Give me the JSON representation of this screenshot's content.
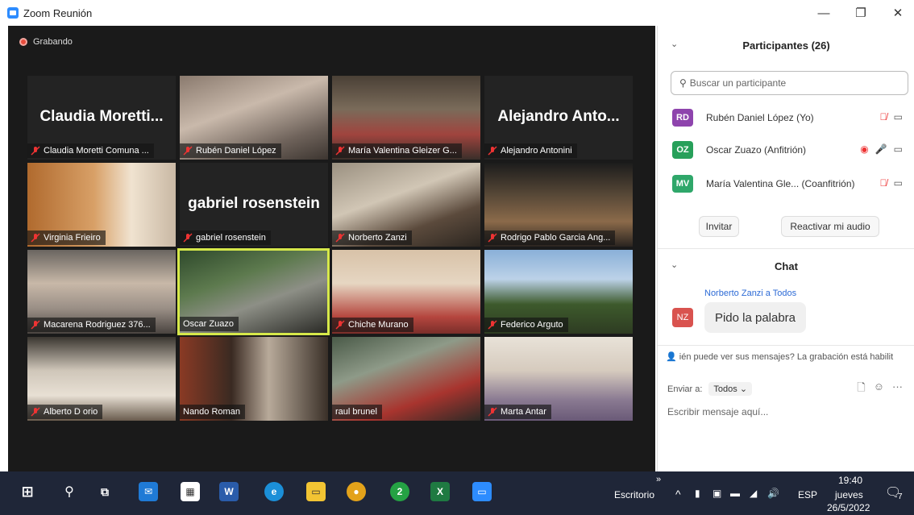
{
  "window": {
    "title": "Zoom Reunión",
    "minimize": "—",
    "maximize": "❐",
    "close": "✕"
  },
  "recording": "Grabando",
  "tiles": [
    {
      "name": "Claudia Moretti Comuna ...",
      "big": "Claudia  Moretti...",
      "muted": true
    },
    {
      "name": "Rubén Daniel López",
      "big": "",
      "muted": true
    },
    {
      "name": "María Valentina Gleizer G...",
      "big": "",
      "muted": true
    },
    {
      "name": "Alejandro Antonini",
      "big": "Alejandro  Anto...",
      "muted": true
    },
    {
      "name": "Virginia Frieiro",
      "big": "",
      "muted": true
    },
    {
      "name": "gabriel rosenstein",
      "big": "gabriel rosenstein",
      "muted": true
    },
    {
      "name": "Norberto Zanzi",
      "big": "",
      "muted": true
    },
    {
      "name": "Rodrigo Pablo Garcia Ang...",
      "big": "",
      "muted": true
    },
    {
      "name": "Macarena Rodriguez 376...",
      "big": "",
      "muted": true
    },
    {
      "name": "Oscar Zuazo",
      "big": "",
      "muted": false
    },
    {
      "name": "Chiche Murano",
      "big": "",
      "muted": true
    },
    {
      "name": "Federico Arguto",
      "big": "",
      "muted": true
    },
    {
      "name": "Alberto D orio",
      "big": "",
      "muted": true
    },
    {
      "name": "Nando Roman",
      "big": "",
      "muted": false
    },
    {
      "name": "raul brunel",
      "big": "",
      "muted": false
    },
    {
      "name": "Marta Antar",
      "big": "",
      "muted": true
    }
  ],
  "participants": {
    "header": "Participantes (26)",
    "search_placeholder": "Buscar un participante",
    "list": [
      {
        "initials": "RD",
        "name": "Rubén Daniel López (Yo)",
        "color": "#8e44ad"
      },
      {
        "initials": "OZ",
        "name": "Oscar Zuazo (Anfitrión)",
        "color": "#27a05a"
      },
      {
        "initials": "MV",
        "name": "María Valentina Gle... (Coanfitrión)",
        "color": "#2fa76a"
      }
    ],
    "invite_label": "Invitar",
    "unmute_label": "Reactivar mi audio"
  },
  "chat": {
    "header": "Chat",
    "sender": "Norberto Zanzi a Todos",
    "sender_initials": "NZ",
    "message": "Pido la palabra",
    "notice": "ién puede ver sus mensajes? La grabación está habilit",
    "send_to_label": "Enviar a:",
    "send_to_value": "Todos ⌄",
    "input_placeholder": "Escribir mensaje aquí..."
  },
  "taskbar": {
    "desktop_label": "Escritorio",
    "lang": "ESP",
    "time": "19:40",
    "day": "jueves",
    "date": "26/5/2022",
    "chrome_badge": "2",
    "notif_count": "7"
  }
}
